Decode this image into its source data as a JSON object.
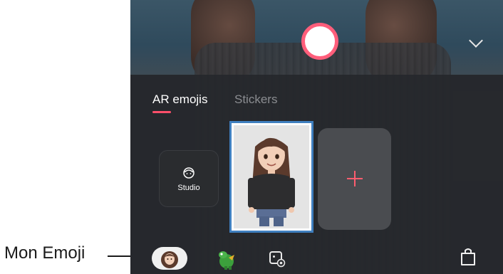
{
  "callout": {
    "label": "Mon Emoji"
  },
  "tabs": [
    {
      "label": "AR emojis",
      "selected": true
    },
    {
      "label": "Stickers",
      "selected": false
    }
  ],
  "tiles": {
    "studio_label": "Studio",
    "add_icon": "plus-icon"
  },
  "icons": {
    "collapse": "chevron-down-icon",
    "shutter": "shutter-button",
    "bottom": [
      "my-emoji-avatar-icon",
      "sticker-character-icon",
      "gallery-icon",
      "store-bag-icon"
    ]
  },
  "colors": {
    "accent": "#ff4f6a",
    "selection": "#3f7fbf"
  }
}
